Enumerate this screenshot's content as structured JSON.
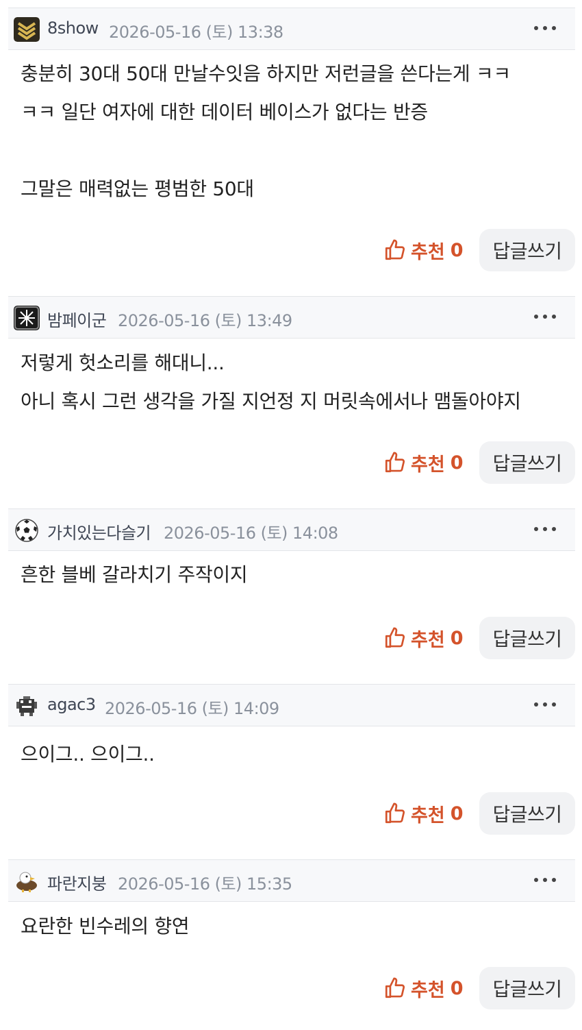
{
  "comments": [
    {
      "avatar": "sergeant-rank-icon",
      "nickname": "8show",
      "date": "2026-05-16 (토) 13:38",
      "lines": [
        "충분히 30대 50대 만날수잇음 하지만 저런글을 쓴다는게 ㅋㅋ",
        "ㅋㅋ 일단 여자에 대한 데이터 베이스가 없다는 반증",
        "",
        "그말은 매력없는 평범한 50대"
      ],
      "like_label": "추천",
      "like_count": "0",
      "reply_label": "답글쓰기"
    },
    {
      "avatar": "snowflake-badge-icon",
      "nickname": "밤페이군",
      "date": "2026-05-16 (토) 13:49",
      "lines": [
        "저렇게 헛소리를 해대니...",
        "아니 혹시 그런 생각을 가질 지언정 지 머릿속에서나 맴돌아야지"
      ],
      "like_label": "추천",
      "like_count": "0",
      "reply_label": "답글쓰기"
    },
    {
      "avatar": "soccer-ball-icon",
      "nickname": "가치있는다슬기",
      "date": "2026-05-16 (토) 14:08",
      "lines": [
        "흔한 블베 갈라치기 주작이지"
      ],
      "like_label": "추천",
      "like_count": "0",
      "reply_label": "답글쓰기"
    },
    {
      "avatar": "pixel-creature-icon",
      "nickname": "agac3",
      "date": "2026-05-16 (토) 14:09",
      "lines": [
        "으이그.. 으이그.."
      ],
      "like_label": "추천",
      "like_count": "0",
      "reply_label": "답글쓰기"
    },
    {
      "avatar": "eagle-icon",
      "nickname": "파란지붕",
      "date": "2026-05-16 (토) 15:35",
      "lines": [
        "요란한 빈수레의 향연"
      ],
      "like_label": "추천",
      "like_count": "0",
      "reply_label": "답글쓰기"
    }
  ],
  "colors": {
    "like_accent": "#d4532b",
    "header_bg": "#f7f8fa",
    "reply_bg": "#f1f2f4"
  }
}
